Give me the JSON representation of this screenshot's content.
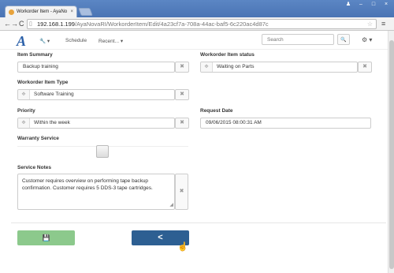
{
  "browser": {
    "tab_title": "Workorder Item - AyaNo",
    "tab_close": "×",
    "url_host": "192.168.1.199",
    "url_path": "/AyaNovaRI/WorkorderItem/Edit/4a23cf7a-708a-44ac-baf5-6c220ac4d87c",
    "nav_back": "←",
    "nav_forward": "→",
    "nav_reload": "C",
    "url_icon": "page-icon",
    "star": "☆",
    "menu": "≡",
    "win_min": "–",
    "win_max": "□",
    "win_close": "×",
    "win_user": "♟"
  },
  "nav": {
    "logo": "A",
    "wrench": "🔧 ▾",
    "schedule": "Schedule",
    "recent": "Recent... ▾",
    "search_placeholder": "Search",
    "search_icon": "🔍",
    "gear": "⚙ ▾"
  },
  "form": {
    "item_summary_label": "Item Summary",
    "item_summary_value": "Backup training",
    "status_label": "Workorder Item status",
    "status_value": "Waiting on Parts",
    "type_label": "Workorder Item Type",
    "type_value": "Software Training",
    "priority_label": "Priority",
    "priority_value": "Within the week",
    "request_date_label": "Request Date",
    "request_date_value": "09/06/2015 08:00:31 AM",
    "warranty_label": "Warranty Service",
    "warranty_checked": false,
    "notes_label": "Service Notes",
    "notes_value": "Customer requires overview on performing tape backup confirmation. Customer requires 5 DDS-3 tape cartridges.",
    "clear_glyph": "✖",
    "select_glyph": "✥",
    "resize_glyph": "◢"
  },
  "actions": {
    "save_glyph": "💾",
    "back_glyph": "<"
  },
  "colors": {
    "save": "#8cc98c",
    "back": "#2d5f92",
    "logo": "#2a5fa8"
  }
}
